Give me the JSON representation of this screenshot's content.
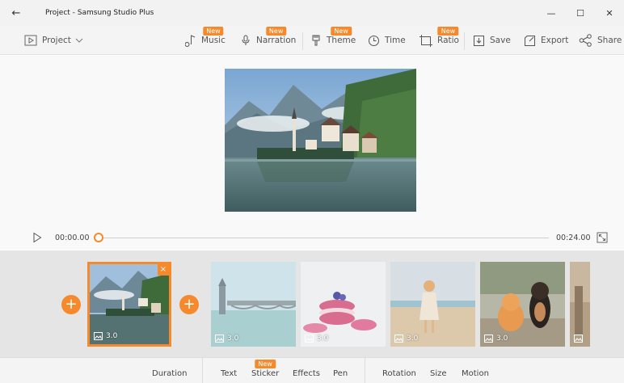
{
  "window": {
    "title": "Project - Samsung Studio Plus",
    "back_icon": "arrow-left-icon",
    "minimize": "—",
    "maximize": "☐",
    "close": "✕"
  },
  "toolbar": {
    "project_label": "Project",
    "music_label": "Music",
    "music_badge": "New",
    "narration_label": "Narration",
    "narration_badge": "New",
    "theme_label": "Theme",
    "theme_badge": "New",
    "time_label": "Time",
    "ratio_label": "Ratio",
    "ratio_badge": "New",
    "save_label": "Save",
    "export_label": "Export",
    "share_label": "Share"
  },
  "player": {
    "current_time": "00:00.00",
    "total_time": "00:24.00",
    "progress": 0
  },
  "timeline": {
    "add_symbol": "+",
    "clips": [
      {
        "duration": "3.0",
        "scene": "lake-village",
        "selected": true
      },
      {
        "duration": "3.0",
        "scene": "london-bridge",
        "selected": false
      },
      {
        "duration": "3.0",
        "scene": "macarons",
        "selected": false
      },
      {
        "duration": "3.0",
        "scene": "girl-beach",
        "selected": false
      },
      {
        "duration": "3.0",
        "scene": "cat-dog",
        "selected": false
      },
      {
        "duration": "",
        "scene": "partial",
        "selected": false
      }
    ]
  },
  "bottom": {
    "duration": "Duration",
    "text": "Text",
    "sticker": "Sticker",
    "sticker_badge": "New",
    "effects": "Effects",
    "pen": "Pen",
    "rotation": "Rotation",
    "size": "Size",
    "motion": "Motion"
  },
  "colors": {
    "accent": "#f6892c"
  }
}
